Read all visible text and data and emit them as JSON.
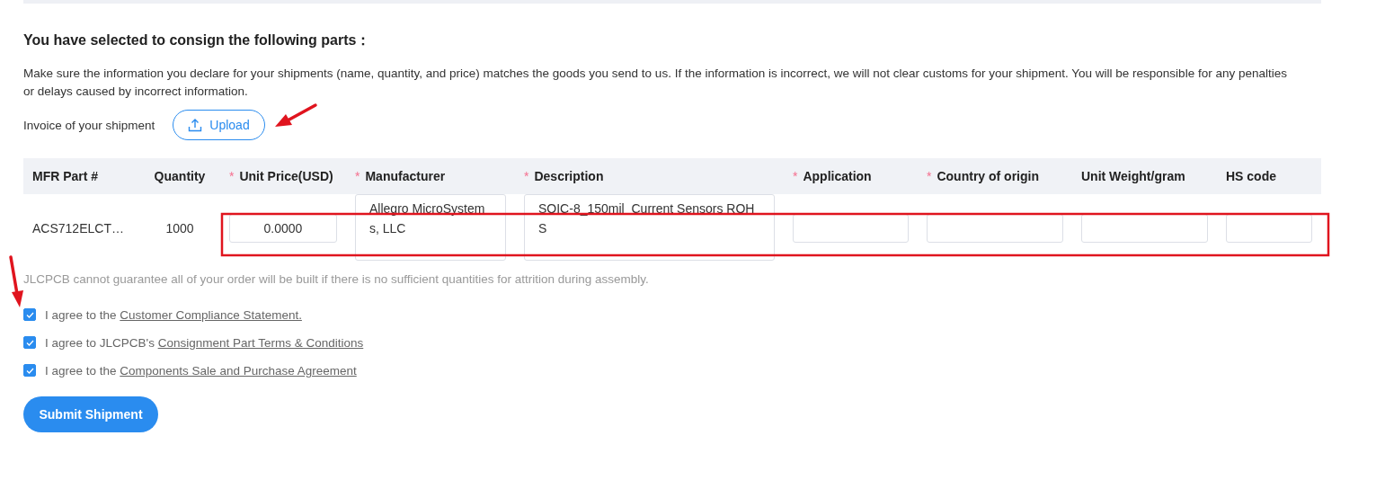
{
  "title": "You have selected to consign the following parts：",
  "notice": "Make sure the information you declare for your shipments (name, quantity, and price) matches the goods you send to us. If the information is incorrect, we will not clear customs for your shipment. You will be responsible for any penalties or delays caused by incorrect information.",
  "invoice": {
    "label": "Invoice of your shipment",
    "button": "Upload"
  },
  "table": {
    "columns": [
      {
        "label": "MFR Part #"
      },
      {
        "label": "Quantity"
      },
      {
        "label": "Unit Price(USD)",
        "required_mark": "*"
      },
      {
        "label": "Manufacturer",
        "required_mark": "*"
      },
      {
        "label": "Description",
        "required_mark": "*"
      },
      {
        "label": "Application",
        "required_mark": "*"
      },
      {
        "label": "Country of origin",
        "required_mark": "*"
      },
      {
        "label": "Unit Weight/gram"
      },
      {
        "label": "HS code"
      }
    ],
    "rows": [
      {
        "cells": [
          {
            "kind": "text",
            "text": "ACS712ELCT…"
          },
          {
            "kind": "text",
            "text": "1000"
          },
          {
            "kind": "input",
            "value": "0.0000"
          },
          {
            "kind": "textarea",
            "value": "Allegro MicroSystems, LLC"
          },
          {
            "kind": "textarea",
            "value": "SOIC-8_150mil  Current Sensors ROHS"
          },
          {
            "kind": "input"
          },
          {
            "kind": "input"
          },
          {
            "kind": "input"
          },
          {
            "kind": "input"
          }
        ]
      }
    ]
  },
  "hint": "JLCPCB cannot guarantee all of your order will be built if there is no sufficient quantities for attrition during assembly.",
  "agreements": [
    {
      "text": "I agree to the ",
      "link": "Customer Compliance Statement.",
      "checked": true
    },
    {
      "text": "I agree to JLCPCB's ",
      "link": "Consignment Part Terms & Conditions",
      "checked": true
    },
    {
      "text": "I agree to the ",
      "link": "Components Sale and Purchase Agreement",
      "checked": true
    }
  ],
  "submit": "Submit Shipment"
}
